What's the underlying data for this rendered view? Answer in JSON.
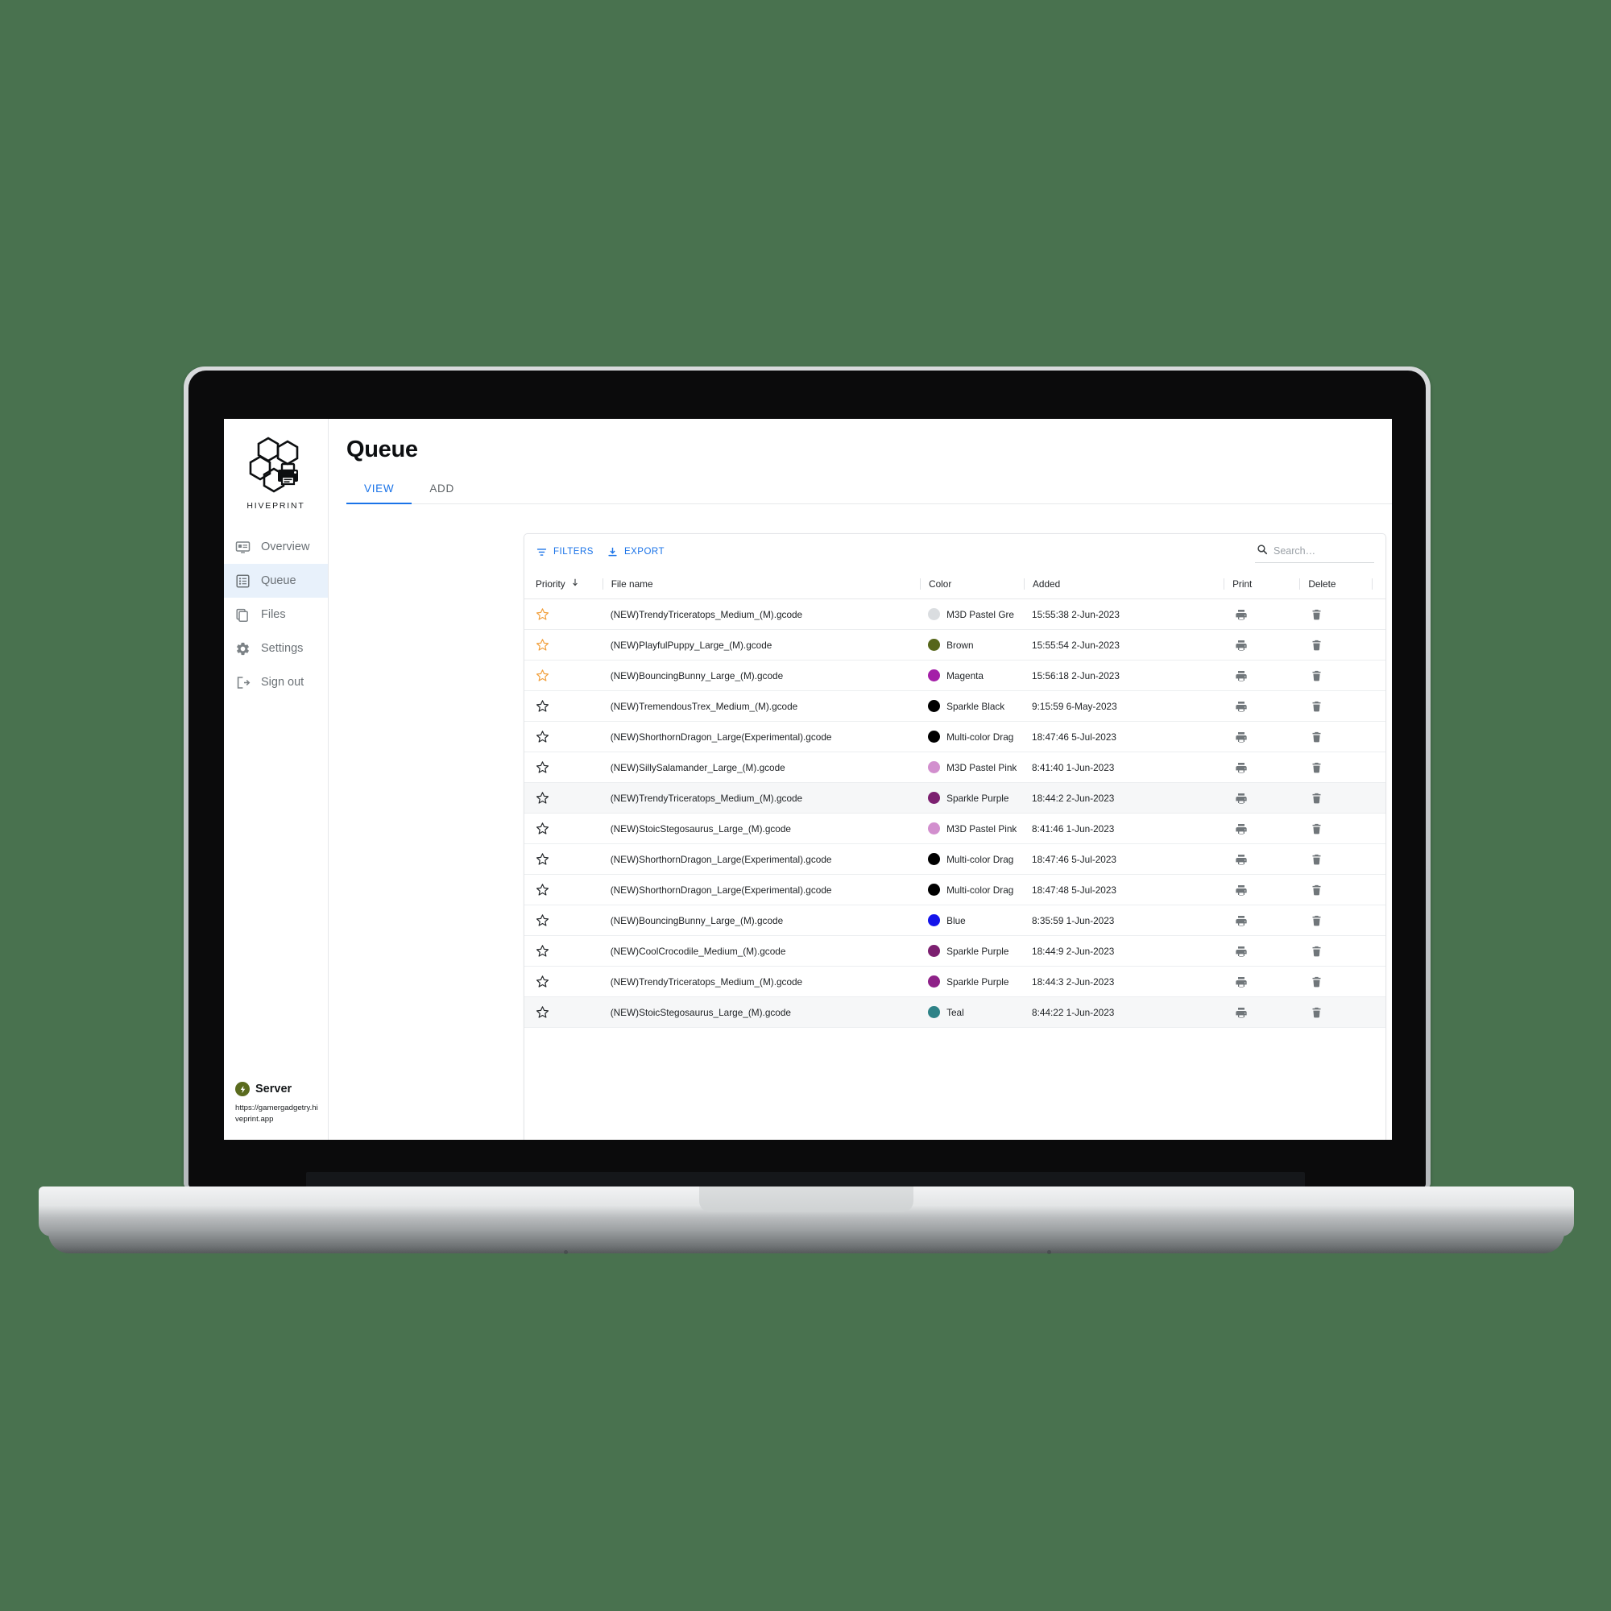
{
  "brand": {
    "name": "HIVEPRINT",
    "logo_icon": "hexagon-printer-logo"
  },
  "sidebar": {
    "items": [
      {
        "label": "Overview",
        "icon": "overview-icon"
      },
      {
        "label": "Queue",
        "icon": "queue-list-icon",
        "active": true
      },
      {
        "label": "Files",
        "icon": "files-copy-icon"
      },
      {
        "label": "Settings",
        "icon": "gear-icon"
      },
      {
        "label": "Sign out",
        "icon": "sign-out-icon"
      }
    ],
    "server": {
      "label": "Server",
      "url": "https://gamergadgetry.hiveprint.app",
      "status_color": "#5a6b1e",
      "status_icon": "power-bolt-icon"
    }
  },
  "header": {
    "title": "Queue",
    "tabs": [
      {
        "label": "VIEW",
        "active": true
      },
      {
        "label": "ADD",
        "active": false
      }
    ]
  },
  "toolbar": {
    "filters_label": "FILTERS",
    "filters_icon": "filter-icon",
    "export_label": "EXPORT",
    "export_icon": "download-icon",
    "search_placeholder": "Search…",
    "search_value": "",
    "search_icon": "search-icon",
    "accent_color": "#1a73e8"
  },
  "table": {
    "columns": [
      {
        "key": "priority",
        "label": "Priority",
        "sort_icon": "arrow-down-icon",
        "sorted": true
      },
      {
        "key": "name",
        "label": "File name"
      },
      {
        "key": "color",
        "label": "Color"
      },
      {
        "key": "added",
        "label": "Added"
      },
      {
        "key": "print",
        "label": "Print"
      },
      {
        "key": "delete",
        "label": "Delete"
      }
    ],
    "print_icon": "printer-icon",
    "delete_icon": "trash-icon",
    "star_filled_color": "#f2a03d",
    "star_empty_color": "#26292c",
    "rows": [
      {
        "priority": true,
        "name": "(NEW)TrendyTriceratops_Medium_(M).gcode",
        "color": "M3D Pastel Gre",
        "swatch": "#dadde0",
        "added": "15:55:38 2-Jun-2023",
        "highlight": false
      },
      {
        "priority": true,
        "name": "(NEW)PlayfulPuppy_Large_(M).gcode",
        "color": "Brown",
        "swatch": "#56661a",
        "added": "15:55:54 2-Jun-2023",
        "highlight": false
      },
      {
        "priority": true,
        "name": "(NEW)BouncingBunny_Large_(M).gcode",
        "color": "Magenta",
        "swatch": "#a41fa8",
        "added": "15:56:18 2-Jun-2023",
        "highlight": false
      },
      {
        "priority": false,
        "name": "(NEW)TremendousTrex_Medium_(M).gcode",
        "color": "Sparkle Black",
        "swatch": "#000000",
        "added": "9:15:59 6-May-2023",
        "highlight": false
      },
      {
        "priority": false,
        "name": "(NEW)ShorthornDragon_Large(Experimental).gcode",
        "color": "Multi-color Drag",
        "swatch": "#000000",
        "added": "18:47:46 5-Jul-2023",
        "highlight": false
      },
      {
        "priority": false,
        "name": "(NEW)SillySalamander_Large_(M).gcode",
        "color": "M3D Pastel Pink",
        "swatch": "#d28fce",
        "added": "8:41:40 1-Jun-2023",
        "highlight": false
      },
      {
        "priority": false,
        "name": "(NEW)TrendyTriceratops_Medium_(M).gcode",
        "color": "Sparkle Purple",
        "swatch": "#7c2070",
        "added": "18:44:2 2-Jun-2023",
        "highlight": true
      },
      {
        "priority": false,
        "name": "(NEW)StoicStegosaurus_Large_(M).gcode",
        "color": "M3D Pastel Pink",
        "swatch": "#d28fce",
        "added": "8:41:46 1-Jun-2023",
        "highlight": false
      },
      {
        "priority": false,
        "name": "(NEW)ShorthornDragon_Large(Experimental).gcode",
        "color": "Multi-color Drag",
        "swatch": "#000000",
        "added": "18:47:46 5-Jul-2023",
        "highlight": false
      },
      {
        "priority": false,
        "name": "(NEW)ShorthornDragon_Large(Experimental).gcode",
        "color": "Multi-color Drag",
        "swatch": "#000000",
        "added": "18:47:48 5-Jul-2023",
        "highlight": false
      },
      {
        "priority": false,
        "name": "(NEW)BouncingBunny_Large_(M).gcode",
        "color": "Blue",
        "swatch": "#1414ea",
        "added": "8:35:59 1-Jun-2023",
        "highlight": false
      },
      {
        "priority": false,
        "name": "(NEW)CoolCrocodile_Medium_(M).gcode",
        "color": "Sparkle Purple",
        "swatch": "#7c2070",
        "added": "18:44:9 2-Jun-2023",
        "highlight": false
      },
      {
        "priority": false,
        "name": "(NEW)TrendyTriceratops_Medium_(M).gcode",
        "color": "Sparkle Purple",
        "swatch": "#8e2288",
        "added": "18:44:3 2-Jun-2023",
        "highlight": false
      },
      {
        "priority": false,
        "name": "(NEW)StoicStegosaurus_Large_(M).gcode",
        "color": "Teal",
        "swatch": "#2e8287",
        "added": "8:44:22 1-Jun-2023",
        "highlight": true
      }
    ]
  },
  "theme": {
    "background_color": "#49724f",
    "accent_color": "#1a73e8",
    "sidebar_active_bg": "#e8f1fb"
  }
}
